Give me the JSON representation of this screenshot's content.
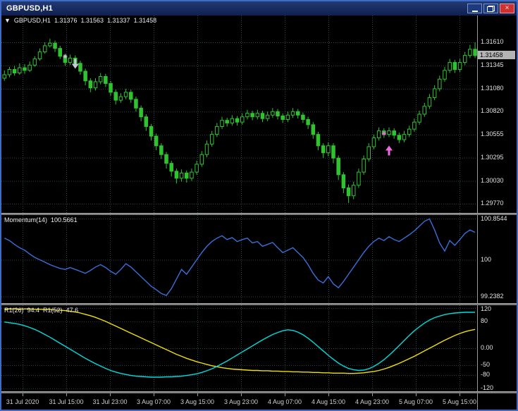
{
  "window": {
    "title": "GBPUSD,H1",
    "buttons": [
      "minimize",
      "restore",
      "close"
    ],
    "close_glyph": "×"
  },
  "header": {
    "collapse_glyph": "▼",
    "symbol_period": "GBPUSD,H1",
    "open": "1.31376",
    "high": "1.31563",
    "low": "1.31337",
    "close": "1.31458"
  },
  "main_chart": {
    "price_scale_labels": [
      "1.31610",
      "1.31345",
      "1.31080",
      "1.30820",
      "1.30555",
      "1.30295",
      "1.30030",
      "1.29770"
    ],
    "current_price": "1.31458",
    "price_max": 1.31915,
    "price_min": 1.29665,
    "markers": [
      {
        "shape": "star",
        "color": "#c8c8dc",
        "bar": 12,
        "price": 1.3145
      },
      {
        "shape": "arrow-down",
        "color": "#c8c8dc",
        "bar": 14,
        "price": 1.3134
      },
      {
        "shape": "star",
        "color": "#ee6ae0",
        "bar": 75,
        "price": 1.3057
      },
      {
        "shape": "arrow-up",
        "color": "#ee6ae0",
        "bar": 76,
        "price": 1.304
      }
    ]
  },
  "momentum_panel": {
    "name": "Momentum(14)",
    "value": "100.5661",
    "scale_labels": [
      "100.8544",
      "100",
      "99.2382"
    ],
    "scale_max": 100.93,
    "scale_min": 99.1,
    "line_color": "#3a6fd8"
  },
  "oscillator_panel": {
    "indicator1_name": "R1(26)",
    "indicator1_value": "94.4",
    "indicator2_name": "R1(52)",
    "indicator2_value": "47.6",
    "scale_labels": [
      "120",
      "80",
      "0.00",
      "-50",
      "-80",
      "-120"
    ],
    "scale_max": 128,
    "scale_min": -128,
    "line1_color": "#f0e000",
    "line2_color": "#00dcdc"
  },
  "time_axis": {
    "labels": [
      "31 Jul 2020",
      "31 Jul 15:00",
      "31 Jul 23:00",
      "3 Aug 07:00",
      "3 Aug 15:00",
      "3 Aug 23:00",
      "4 Aug 07:00",
      "4 Aug 15:00",
      "4 Aug 23:00",
      "5 Aug 07:00",
      "5 Aug 15:00"
    ]
  },
  "colors": {
    "background": "#000000",
    "grid": "#33454d",
    "candle": "#2fc42f",
    "text": "#ececec",
    "scale_divider": "#9a9a9a",
    "current_price_bg": "#b4b4b4",
    "window_border": "#3d6bc6",
    "separator": "#7d7d7d"
  },
  "chart_data": [
    {
      "type": "candlestick",
      "title": "GBPUSD H1",
      "ylim": [
        1.29665,
        1.31915
      ],
      "ohlc": [
        [
          1.312,
          1.3129,
          1.3117,
          1.3124
        ],
        [
          1.3124,
          1.3133,
          1.3121,
          1.313
        ],
        [
          1.313,
          1.3134,
          1.3123,
          1.3126
        ],
        [
          1.3126,
          1.3137,
          1.3124,
          1.3132
        ],
        [
          1.3132,
          1.3136,
          1.3125,
          1.3129
        ],
        [
          1.3129,
          1.3139,
          1.3127,
          1.3135
        ],
        [
          1.3135,
          1.3145,
          1.3133,
          1.3142
        ],
        [
          1.3142,
          1.3154,
          1.314,
          1.315
        ],
        [
          1.315,
          1.3161,
          1.3148,
          1.3157
        ],
        [
          1.3157,
          1.3165,
          1.3155,
          1.316
        ],
        [
          1.316,
          1.3163,
          1.315,
          1.3154
        ],
        [
          1.3154,
          1.3157,
          1.3142,
          1.3145
        ],
        [
          1.3145,
          1.3148,
          1.3134,
          1.3138
        ],
        [
          1.3138,
          1.3147,
          1.3135,
          1.3143
        ],
        [
          1.3143,
          1.3146,
          1.3133,
          1.3137
        ],
        [
          1.3137,
          1.314,
          1.3124,
          1.3128
        ],
        [
          1.3128,
          1.3131,
          1.3112,
          1.3117
        ],
        [
          1.3117,
          1.312,
          1.3104,
          1.3109
        ],
        [
          1.3109,
          1.312,
          1.3106,
          1.3116
        ],
        [
          1.3116,
          1.3126,
          1.3113,
          1.3122
        ],
        [
          1.3122,
          1.3125,
          1.311,
          1.3114
        ],
        [
          1.3114,
          1.3117,
          1.31,
          1.3104
        ],
        [
          1.3104,
          1.3107,
          1.309,
          1.3095
        ],
        [
          1.3095,
          1.3103,
          1.3092,
          1.3099
        ],
        [
          1.3099,
          1.3108,
          1.3096,
          1.3104
        ],
        [
          1.3104,
          1.3107,
          1.3092,
          1.3096
        ],
        [
          1.3096,
          1.3099,
          1.3082,
          1.3086
        ],
        [
          1.3086,
          1.3089,
          1.3071,
          1.3076
        ],
        [
          1.3076,
          1.3079,
          1.306,
          1.3065
        ],
        [
          1.3065,
          1.3068,
          1.3049,
          1.3054
        ],
        [
          1.3054,
          1.3057,
          1.3038,
          1.3043
        ],
        [
          1.3043,
          1.3046,
          1.3028,
          1.3033
        ],
        [
          1.3033,
          1.3036,
          1.3017,
          1.3023
        ],
        [
          1.3023,
          1.3026,
          1.3008,
          1.3014
        ],
        [
          1.3014,
          1.3017,
          1.3,
          1.3006
        ],
        [
          1.3006,
          1.3016,
          1.3002,
          1.3012
        ],
        [
          1.3012,
          1.3015,
          1.3001,
          1.3006
        ],
        [
          1.3006,
          1.3017,
          1.3003,
          1.3013
        ],
        [
          1.3013,
          1.3026,
          1.301,
          1.3022
        ],
        [
          1.3022,
          1.3037,
          1.3019,
          1.3033
        ],
        [
          1.3033,
          1.3049,
          1.303,
          1.3045
        ],
        [
          1.3045,
          1.306,
          1.3042,
          1.3056
        ],
        [
          1.3056,
          1.3069,
          1.3053,
          1.3065
        ],
        [
          1.3065,
          1.3076,
          1.3062,
          1.3072
        ],
        [
          1.3072,
          1.3075,
          1.3065,
          1.3069
        ],
        [
          1.3069,
          1.3078,
          1.3066,
          1.3074
        ],
        [
          1.3074,
          1.3077,
          1.3066,
          1.307
        ],
        [
          1.307,
          1.308,
          1.3067,
          1.3076
        ],
        [
          1.3076,
          1.3084,
          1.3073,
          1.308
        ],
        [
          1.308,
          1.3083,
          1.3072,
          1.3076
        ],
        [
          1.3076,
          1.3084,
          1.3073,
          1.308
        ],
        [
          1.308,
          1.3083,
          1.307,
          1.3074
        ],
        [
          1.3074,
          1.3082,
          1.3071,
          1.3078
        ],
        [
          1.3078,
          1.3086,
          1.3075,
          1.3082
        ],
        [
          1.3082,
          1.3085,
          1.3073,
          1.3077
        ],
        [
          1.3077,
          1.308,
          1.3069,
          1.3073
        ],
        [
          1.3073,
          1.3082,
          1.307,
          1.3078
        ],
        [
          1.3078,
          1.3086,
          1.3075,
          1.3082
        ],
        [
          1.3082,
          1.3085,
          1.3074,
          1.3078
        ],
        [
          1.3078,
          1.3081,
          1.3069,
          1.3073
        ],
        [
          1.3073,
          1.3076,
          1.3062,
          1.3067
        ],
        [
          1.3067,
          1.307,
          1.3051,
          1.3056
        ],
        [
          1.3056,
          1.3059,
          1.3038,
          1.3043
        ],
        [
          1.3043,
          1.3046,
          1.3029,
          1.3035
        ],
        [
          1.3035,
          1.3047,
          1.3031,
          1.3043
        ],
        [
          1.3043,
          1.3046,
          1.3023,
          1.3029
        ],
        [
          1.3029,
          1.3032,
          1.3004,
          1.301
        ],
        [
          1.301,
          1.3013,
          1.2989,
          1.2995
        ],
        [
          1.2995,
          1.2999,
          1.2978,
          1.2986
        ],
        [
          1.2986,
          1.3002,
          1.2982,
          1.2998
        ],
        [
          1.2998,
          1.3017,
          1.2995,
          1.3013
        ],
        [
          1.3013,
          1.3032,
          1.301,
          1.3028
        ],
        [
          1.3028,
          1.3046,
          1.3025,
          1.3042
        ],
        [
          1.3042,
          1.3056,
          1.3039,
          1.3052
        ],
        [
          1.3052,
          1.3064,
          1.3049,
          1.306
        ],
        [
          1.306,
          1.3063,
          1.3052,
          1.3056
        ],
        [
          1.3056,
          1.3064,
          1.3053,
          1.306
        ],
        [
          1.306,
          1.3063,
          1.3051,
          1.3055
        ],
        [
          1.3055,
          1.3058,
          1.3046,
          1.305
        ],
        [
          1.305,
          1.306,
          1.3047,
          1.3056
        ],
        [
          1.3056,
          1.3066,
          1.3053,
          1.3062
        ],
        [
          1.3062,
          1.3074,
          1.3059,
          1.307
        ],
        [
          1.307,
          1.3083,
          1.3067,
          1.3079
        ],
        [
          1.3079,
          1.3092,
          1.3076,
          1.3088
        ],
        [
          1.3088,
          1.3102,
          1.3085,
          1.3098
        ],
        [
          1.3098,
          1.3112,
          1.3095,
          1.3108
        ],
        [
          1.3108,
          1.3123,
          1.3105,
          1.3119
        ],
        [
          1.3119,
          1.3133,
          1.3116,
          1.3129
        ],
        [
          1.3129,
          1.3142,
          1.3126,
          1.3138
        ],
        [
          1.3138,
          1.3141,
          1.3126,
          1.313
        ],
        [
          1.313,
          1.3142,
          1.3127,
          1.3138
        ],
        [
          1.3138,
          1.315,
          1.3135,
          1.3146
        ],
        [
          1.3146,
          1.3158,
          1.3143,
          1.3153
        ],
        [
          1.3153,
          1.3161,
          1.3143,
          1.31458
        ]
      ]
    },
    {
      "type": "line",
      "name": "Momentum(14)",
      "ylim": [
        99.1,
        100.93
      ],
      "values": [
        100.45,
        100.4,
        100.32,
        100.25,
        100.2,
        100.12,
        100.05,
        100.0,
        99.95,
        99.9,
        99.86,
        99.82,
        99.8,
        99.84,
        99.8,
        99.76,
        99.72,
        99.78,
        99.85,
        99.9,
        99.84,
        99.76,
        99.7,
        99.8,
        99.92,
        99.85,
        99.75,
        99.65,
        99.55,
        99.45,
        99.38,
        99.3,
        99.26,
        99.4,
        99.6,
        99.8,
        99.7,
        99.85,
        100.0,
        100.15,
        100.28,
        100.38,
        100.45,
        100.5,
        100.42,
        100.46,
        100.38,
        100.42,
        100.45,
        100.35,
        100.38,
        100.28,
        100.32,
        100.36,
        100.25,
        100.15,
        100.2,
        100.25,
        100.15,
        100.05,
        99.9,
        99.72,
        99.58,
        99.52,
        99.65,
        99.5,
        99.42,
        99.55,
        99.7,
        99.85,
        100.0,
        100.15,
        100.28,
        100.38,
        100.45,
        100.4,
        100.48,
        100.42,
        100.38,
        100.45,
        100.52,
        100.6,
        100.7,
        100.8,
        100.85,
        100.62,
        100.35,
        100.18,
        100.4,
        100.3,
        100.42,
        100.55,
        100.62,
        100.57
      ]
    },
    {
      "type": "line",
      "ylim": [
        -128,
        128
      ],
      "series": [
        {
          "name": "R1(26)",
          "values": [
            116,
            117,
            117,
            116,
            117,
            117,
            116,
            116,
            115,
            115,
            114,
            113,
            112,
            110,
            108,
            105,
            101,
            97,
            92,
            86,
            80,
            73,
            66,
            59,
            52,
            45,
            38,
            31,
            24,
            17,
            10,
            3,
            -4,
            -11,
            -18,
            -24,
            -30,
            -35,
            -40,
            -44,
            -48,
            -52,
            -55,
            -58,
            -60,
            -62,
            -63,
            -64,
            -65,
            -66,
            -66,
            -67,
            -67,
            -68,
            -68,
            -69,
            -69,
            -70,
            -70,
            -71,
            -71,
            -72,
            -72,
            -73,
            -73,
            -74,
            -74,
            -74,
            -75,
            -75,
            -74,
            -73,
            -71,
            -69,
            -66,
            -62,
            -57,
            -51,
            -45,
            -38,
            -31,
            -24,
            -16,
            -8,
            0,
            8,
            16,
            24,
            31,
            38,
            44,
            49,
            53,
            56
          ]
        },
        {
          "name": "R1(52)",
          "values": [
            78,
            76,
            74,
            71,
            67,
            62,
            56,
            49,
            41,
            33,
            24,
            15,
            6,
            -3,
            -12,
            -21,
            -30,
            -38,
            -46,
            -53,
            -60,
            -66,
            -71,
            -75,
            -78,
            -81,
            -83,
            -84,
            -85,
            -86,
            -86,
            -86,
            -85,
            -85,
            -84,
            -83,
            -81,
            -79,
            -76,
            -72,
            -67,
            -61,
            -54,
            -46,
            -38,
            -29,
            -20,
            -11,
            -2,
            7,
            16,
            25,
            33,
            41,
            47,
            52,
            55,
            53,
            48,
            40,
            30,
            18,
            5,
            -8,
            -21,
            -33,
            -44,
            -53,
            -60,
            -64,
            -66,
            -65,
            -61,
            -54,
            -45,
            -34,
            -21,
            -7,
            8,
            23,
            38,
            52,
            64,
            75,
            84,
            91,
            96,
            100,
            103,
            105,
            106,
            107,
            107,
            107
          ]
        }
      ]
    }
  ]
}
